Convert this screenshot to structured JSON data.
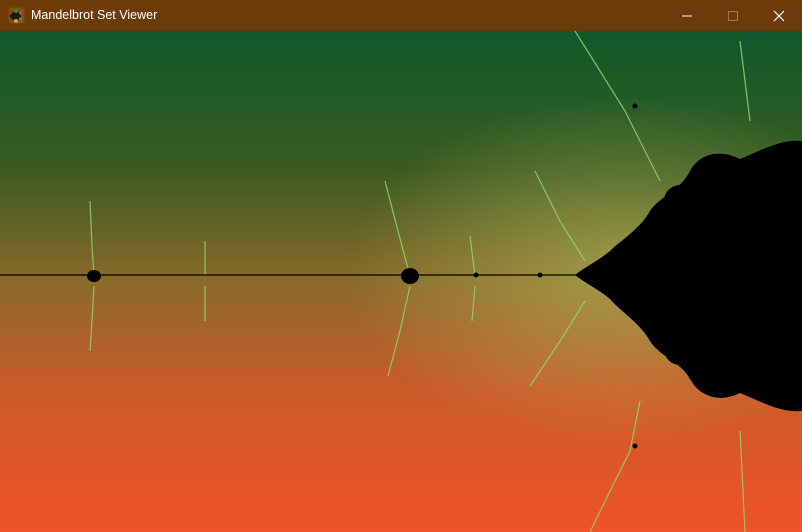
{
  "window": {
    "title": "Mandelbrot Set Viewer",
    "app_icon": "mandelbrot-app-icon",
    "controls": {
      "minimize_icon": "minimize-icon",
      "maximize_icon": "maximize-icon",
      "close_icon": "close-icon"
    }
  },
  "colors": {
    "titlebar": "#6e3a0a",
    "gradient_top": "#0d5a2a",
    "gradient_mid": "#7a6a2a",
    "gradient_bottom": "#f0522a",
    "set_interior": "#000000",
    "filament": "#8fd86a"
  }
}
